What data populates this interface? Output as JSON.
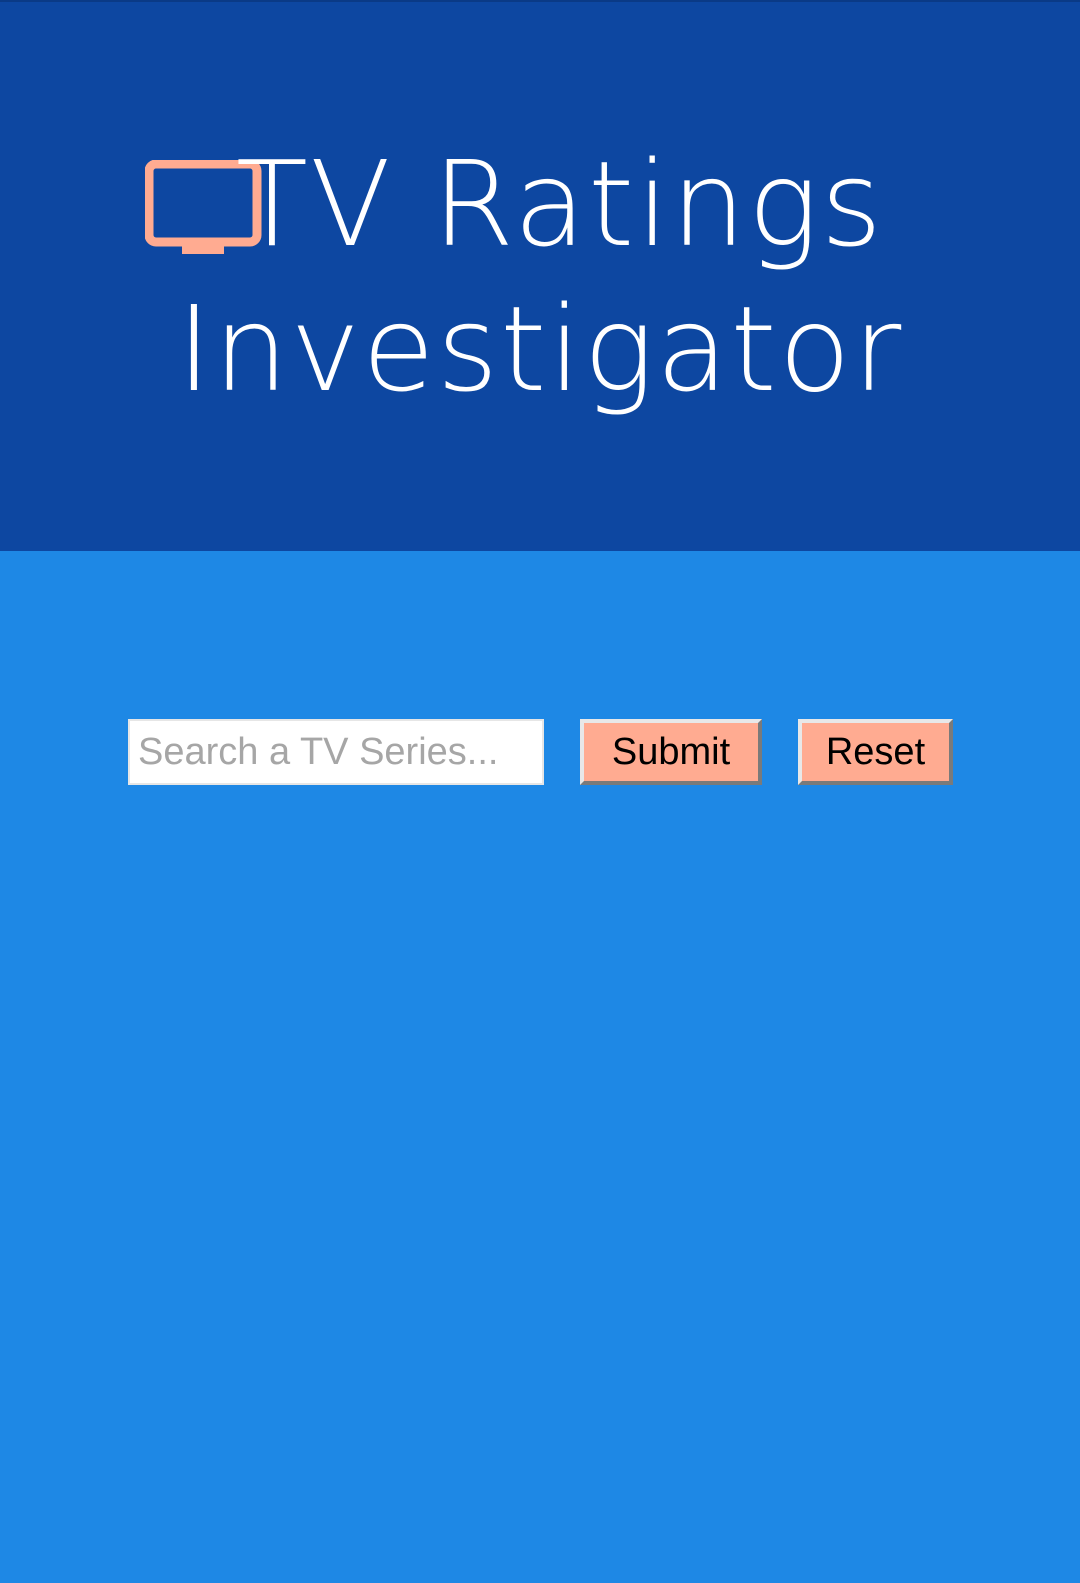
{
  "header": {
    "title_line1": "TV Ratings",
    "title_line2": "Investigator",
    "icon": "tv-icon",
    "background_color": "#0d47a1",
    "icon_color": "#ffab91"
  },
  "search": {
    "placeholder": "Search a TV Series...",
    "value": "",
    "submit_label": "Submit",
    "reset_label": "Reset"
  },
  "colors": {
    "page_background": "#1e88e5",
    "button_background": "#ffab91",
    "title_text": "#ffffff"
  }
}
